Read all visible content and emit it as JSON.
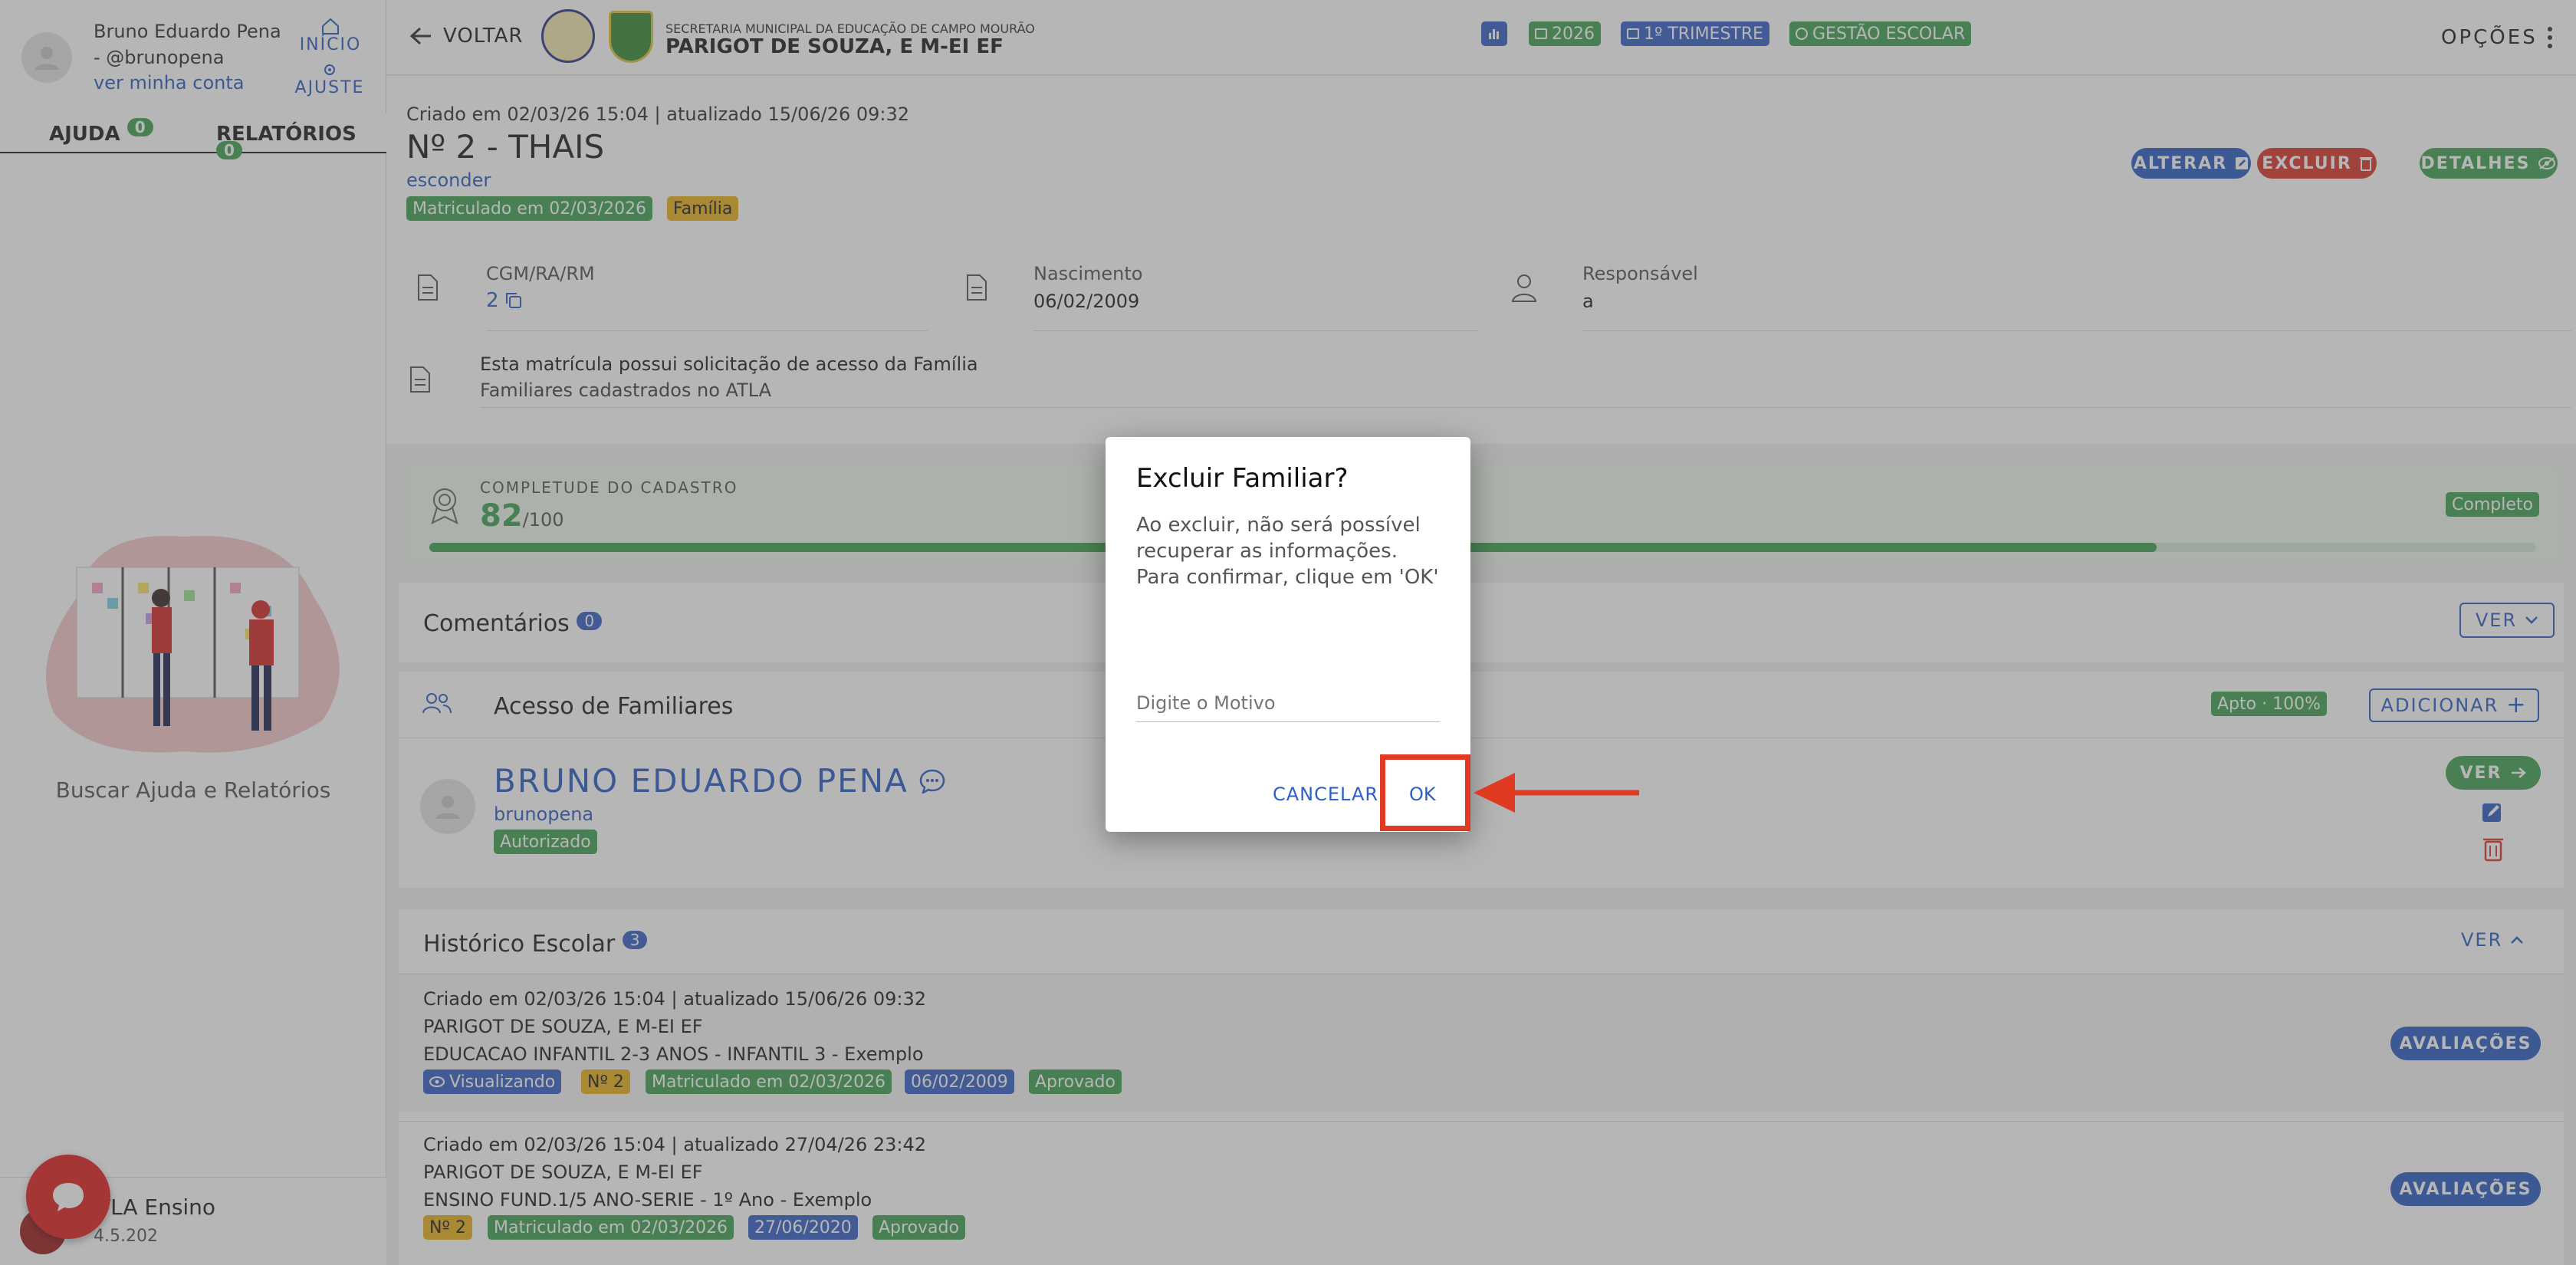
{
  "user": {
    "name_line1": "Bruno Eduardo Pena",
    "name_line2": "- @brunopena",
    "account_link": "ver minha conta"
  },
  "sidebar": {
    "inicio": "INÍCIO",
    "ajuste": "AJUSTE",
    "tabs": [
      {
        "label": "AJUDA",
        "count": "0"
      },
      {
        "label": "RELATÓRIOS",
        "count": "0"
      }
    ],
    "help_text": "Buscar Ajuda e Relatórios",
    "app_name": "ATLA Ensino",
    "version": "4.5.202"
  },
  "header": {
    "back": "VOLTAR",
    "secretaria": "SECRETARIA MUNICIPAL DA EDUCAÇÃO DE CAMPO MOURÃO",
    "school": "PARIGOT DE SOUZA, E M-EI EF",
    "year": "2026",
    "trimestre": "1º TRIMESTRE",
    "gestao": "GESTÃO ESCOLAR",
    "opcoes": "OPÇÕES"
  },
  "student": {
    "created": "Criado em 02/03/26 15:04 | atualizado 15/06/26 09:32",
    "title": "Nº 2 - THAIS",
    "hide": "esconder",
    "matriculado": "Matriculado em 02/03/2026",
    "familia": "Família",
    "alterar": "ALTERAR",
    "excluir": "EXCLUIR",
    "detalhes": "DETALHES",
    "cgm_label": "CGM/RA/RM",
    "cgm_value": "2",
    "nasc_label": "Nascimento",
    "nasc_value": "06/02/2009",
    "resp_label": "Responsável",
    "resp_value": "a",
    "access_title": "Esta matrícula possui solicitação de acesso da Família",
    "access_sub": "Familiares cadastrados no ATLA"
  },
  "completude": {
    "label": "COMPLETUDE DO CADASTRO",
    "value": "82",
    "max": "/100",
    "status": "Completo",
    "fraction": 0.82
  },
  "comentarios": {
    "title": "Comentários",
    "count": "0",
    "ver": "VER"
  },
  "familiares": {
    "title": "Acesso de Familiares",
    "apto": "Apto · 100%",
    "adicionar": "ADICIONAR",
    "member_name": "BRUNO EDUARDO PENA",
    "member_user": "brunopena",
    "member_status": "Autorizado",
    "ver": "VER"
  },
  "historico": {
    "title": "Histórico Escolar",
    "count": "3",
    "ver": "VER",
    "entries": [
      {
        "created": "Criado em 02/03/26 15:04 | atualizado 15/06/26 09:32",
        "school": "PARIGOT DE SOUZA, E M-EI EF",
        "course": "EDUCACAO INFANTIL 2-3 ANOS - INFANTIL 3 - Exemplo",
        "visual": "Visualizando",
        "num": "Nº 2",
        "mat": "Matriculado em 02/03/2026",
        "date": "06/02/2009",
        "status": "Aprovado",
        "btn": "AVALIAÇÕES"
      },
      {
        "created": "Criado em 02/03/26 15:04 | atualizado 27/04/26 23:42",
        "school": "PARIGOT DE SOUZA, E M-EI EF",
        "course": "ENSINO FUND.1/5 ANO-SERIE - 1º Ano - Exemplo",
        "num": "Nº 2",
        "mat": "Matriculado em 02/03/2026",
        "date": "27/06/2020",
        "status": "Aprovado",
        "btn": "AVALIAÇÕES"
      }
    ]
  },
  "dialog": {
    "title": "Excluir Familiar?",
    "message": "Ao excluir, não será possível recuperar as informações. Para confirmar, clique em 'OK'",
    "placeholder": "Digite o Motivo",
    "cancel": "CANCELAR",
    "ok": "OK"
  },
  "colors": {
    "accent_blue": "#2d5fc4",
    "green": "#44a355",
    "red": "#d93a2f",
    "annotation_red": "#e03a22"
  }
}
